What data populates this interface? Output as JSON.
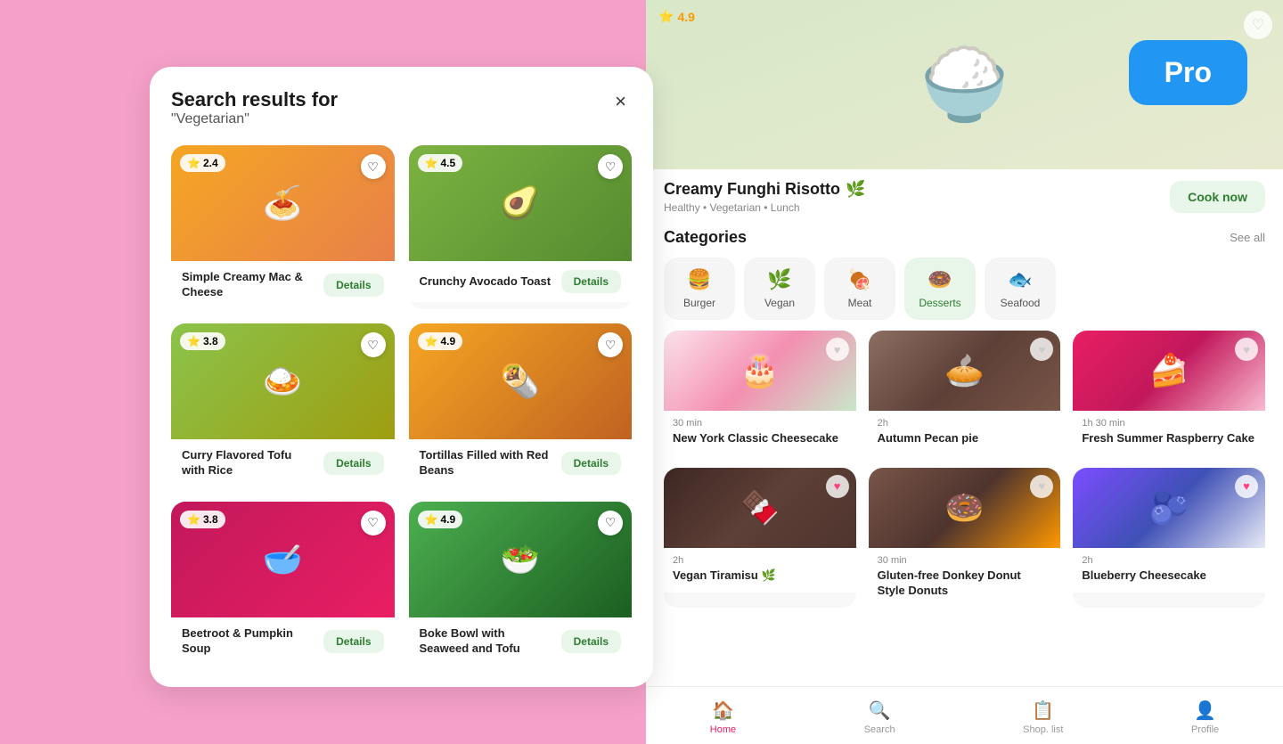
{
  "pro_badge": "Pro",
  "search_panel": {
    "title": "Search results for",
    "subtitle": "\"Vegetarian\"",
    "close_label": "×",
    "recipes": [
      {
        "id": "mac-cheese",
        "name": "Simple Creamy Mac & Cheese",
        "rating": "2.4",
        "details_label": "Details",
        "img_class": "img-mac",
        "emoji": "🍝",
        "heart_filled": false
      },
      {
        "id": "avocado-toast",
        "name": "Crunchy Avocado Toast",
        "rating": "4.5",
        "details_label": "Details",
        "img_class": "img-avocado",
        "emoji": "🥑",
        "heart_filled": false
      },
      {
        "id": "tofu-rice",
        "name": "Curry Flavored Tofu with Rice",
        "rating": "3.8",
        "details_label": "Details",
        "img_class": "img-tofu",
        "emoji": "🍛",
        "heart_filled": false
      },
      {
        "id": "tortillas",
        "name": "Tortillas Filled with Red Beans",
        "rating": "4.9",
        "details_label": "Details",
        "img_class": "img-tortillas",
        "emoji": "🌯",
        "heart_filled": false
      },
      {
        "id": "beetroot",
        "name": "Beetroot & Pumpkin Soup",
        "rating": "3.8",
        "details_label": "Details",
        "img_class": "img-beetroot",
        "emoji": "🥣",
        "heart_filled": false
      },
      {
        "id": "boke-bowl",
        "name": "Boke Bowl with Seaweed and Tofu",
        "rating": "4.9",
        "details_label": "Details",
        "img_class": "img-boke",
        "emoji": "🥗",
        "heart_filled": false
      }
    ]
  },
  "hero": {
    "rating": "4.9",
    "emoji": "🍚"
  },
  "recipe": {
    "name": "Creamy Funghi Risotto",
    "leaf_emoji": "🌿",
    "tags": "Healthy  •  Vegetarian  •  Lunch",
    "cook_now_label": "Cook now"
  },
  "categories": {
    "title": "Categories",
    "see_all_label": "See all",
    "items": [
      {
        "id": "burger",
        "label": "Burger",
        "emoji": "🍔",
        "active": false
      },
      {
        "id": "vegan",
        "label": "Vegan",
        "emoji": "🌿",
        "active": false
      },
      {
        "id": "meat",
        "label": "Meat",
        "emoji": "🍖",
        "active": false
      },
      {
        "id": "desserts",
        "label": "Desserts",
        "emoji": "🍩",
        "active": true
      },
      {
        "id": "seafood",
        "label": "Seafood",
        "emoji": "🐟",
        "active": false
      }
    ]
  },
  "food_cards": [
    {
      "id": "ny-cheesecake",
      "time": "30 min",
      "name": "New York Classic Cheesecake",
      "img_class": "img-cheesecake",
      "emoji": "🎂",
      "heart_color": "#ccc"
    },
    {
      "id": "pecan-pie",
      "time": "2h",
      "name": "Autumn Pecan pie",
      "img_class": "img-pecan",
      "emoji": "🥧",
      "heart_color": "#ccc"
    },
    {
      "id": "raspberry-cake",
      "time": "1h 30 min",
      "name": "Fresh Summer Raspberry Cake",
      "img_class": "img-raspberry",
      "emoji": "🍰",
      "heart_color": "#ccc"
    },
    {
      "id": "tiramisu",
      "time": "2h",
      "name": "Vegan Tiramisu",
      "leaf_emoji": "🌿",
      "img_class": "img-tiramisu",
      "emoji": "🍫",
      "heart_color": "#ff4081"
    },
    {
      "id": "donuts",
      "time": "30 min",
      "name": "Gluten-free Donkey Donut Style Donuts",
      "img_class": "img-donut",
      "emoji": "🍩",
      "heart_color": "#ccc"
    },
    {
      "id": "blueberry-cake",
      "time": "2h",
      "name": "Blueberry Cheesecake",
      "img_class": "img-blueberry",
      "emoji": "🫐",
      "heart_color": "#ff4081"
    }
  ],
  "bottom_nav": {
    "items": [
      {
        "id": "home",
        "label": "Home",
        "emoji": "🏠",
        "active": true
      },
      {
        "id": "search",
        "label": "Search",
        "emoji": "🔍",
        "active": false
      },
      {
        "id": "shop-list",
        "label": "Shop. list",
        "emoji": "📋",
        "active": false
      },
      {
        "id": "profile",
        "label": "Profile",
        "emoji": "👤",
        "active": false
      }
    ]
  }
}
